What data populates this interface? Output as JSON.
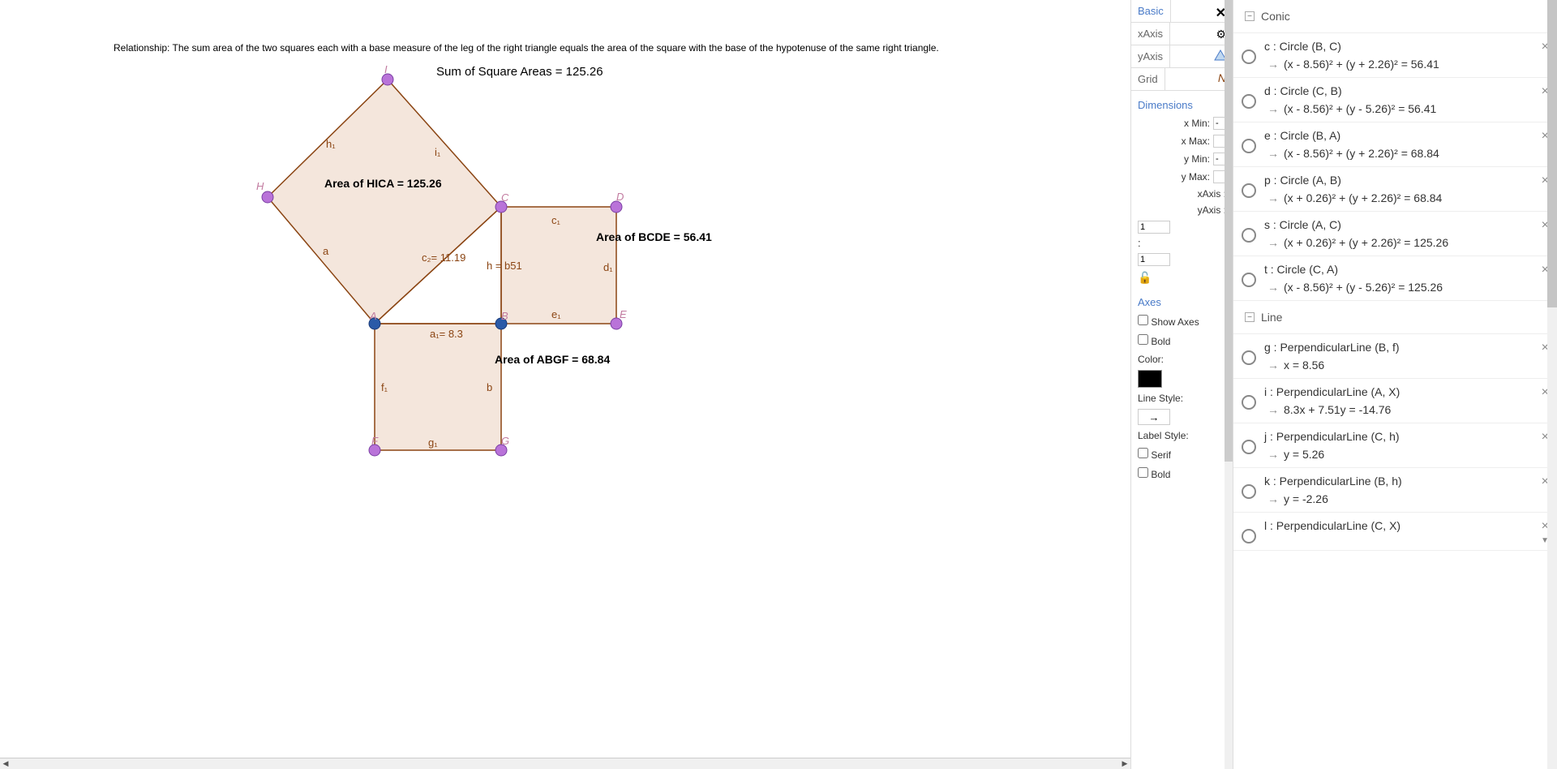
{
  "description": "Relationship: The sum area of the two squares each with a base measure of the leg of the right triangle equals the area of the square with the base of the hypotenuse of the same right triangle.",
  "sum_text": "Sum of Square Areas = 125.26",
  "areas": {
    "hica": "Area of  HICA = 125.26",
    "bcde": "Area of  BCDE = 56.41",
    "abgf": "Area of  ABGF = 68.84"
  },
  "points": {
    "I": "I",
    "H": "H",
    "C": "C",
    "D": "D",
    "A": "A",
    "B": "B",
    "E": "E",
    "F": "F",
    "G": "G"
  },
  "segments": {
    "h1": "h₁",
    "i1": "i₁",
    "a": "a",
    "c2": "c₂= 11.19",
    "c1": "c₁",
    "hb": "h = b51",
    "d1": "d₁",
    "a1": "a₁= 8.3",
    "e1": "e₁",
    "f1": "f₁",
    "b": "b",
    "g1": "g₁"
  },
  "tabs": {
    "basic": "Basic",
    "xaxis": "xAxis",
    "yaxis": "yAxis",
    "grid": "Grid"
  },
  "dims": {
    "title": "Dimensions",
    "xmin": "x Min:",
    "xmax": "x Max:",
    "ymin": "y Min:",
    "ymax": "y Max:",
    "xaxis": "xAxis :",
    "yaxis": "yAxis :",
    "xaxis_val": "1",
    "yaxis_val": "1"
  },
  "axes": {
    "title": "Axes",
    "show": "Show Axes",
    "bold": "Bold",
    "color": "Color:",
    "linestyle": "Line Style:",
    "labelstyle": "Label Style:",
    "serif": "Serif",
    "bold2": "Bold"
  },
  "sections": {
    "conic": "Conic",
    "line": "Line"
  },
  "objects": [
    {
      "def": "c : Circle (B, C)",
      "eq": "(x - 8.56)² + (y + 2.26)² = 56.41"
    },
    {
      "def": "d : Circle (C, B)",
      "eq": "(x - 8.56)² + (y - 5.26)² = 56.41"
    },
    {
      "def": "e : Circle (B, A)",
      "eq": "(x - 8.56)² + (y + 2.26)² = 68.84"
    },
    {
      "def": "p : Circle (A, B)",
      "eq": "(x + 0.26)² + (y + 2.26)² = 68.84"
    },
    {
      "def": "s : Circle (A, C)",
      "eq": "(x + 0.26)² + (y + 2.26)² = 125.26"
    },
    {
      "def": "t : Circle (C, A)",
      "eq": "(x - 8.56)² + (y - 5.26)² = 125.26"
    }
  ],
  "lines": [
    {
      "def": "g : PerpendicularLine (B, f)",
      "eq": "x = 8.56"
    },
    {
      "def": "i : PerpendicularLine (A, X)",
      "eq": "8.3x + 7.51y = -14.76"
    },
    {
      "def": "j : PerpendicularLine (C, h)",
      "eq": "y = 5.26"
    },
    {
      "def": "k : PerpendicularLine (B, h)",
      "eq": "y = -2.26"
    },
    {
      "def": "l : PerpendicularLine (C, X)",
      "eq": "",
      "partial": true
    }
  ]
}
